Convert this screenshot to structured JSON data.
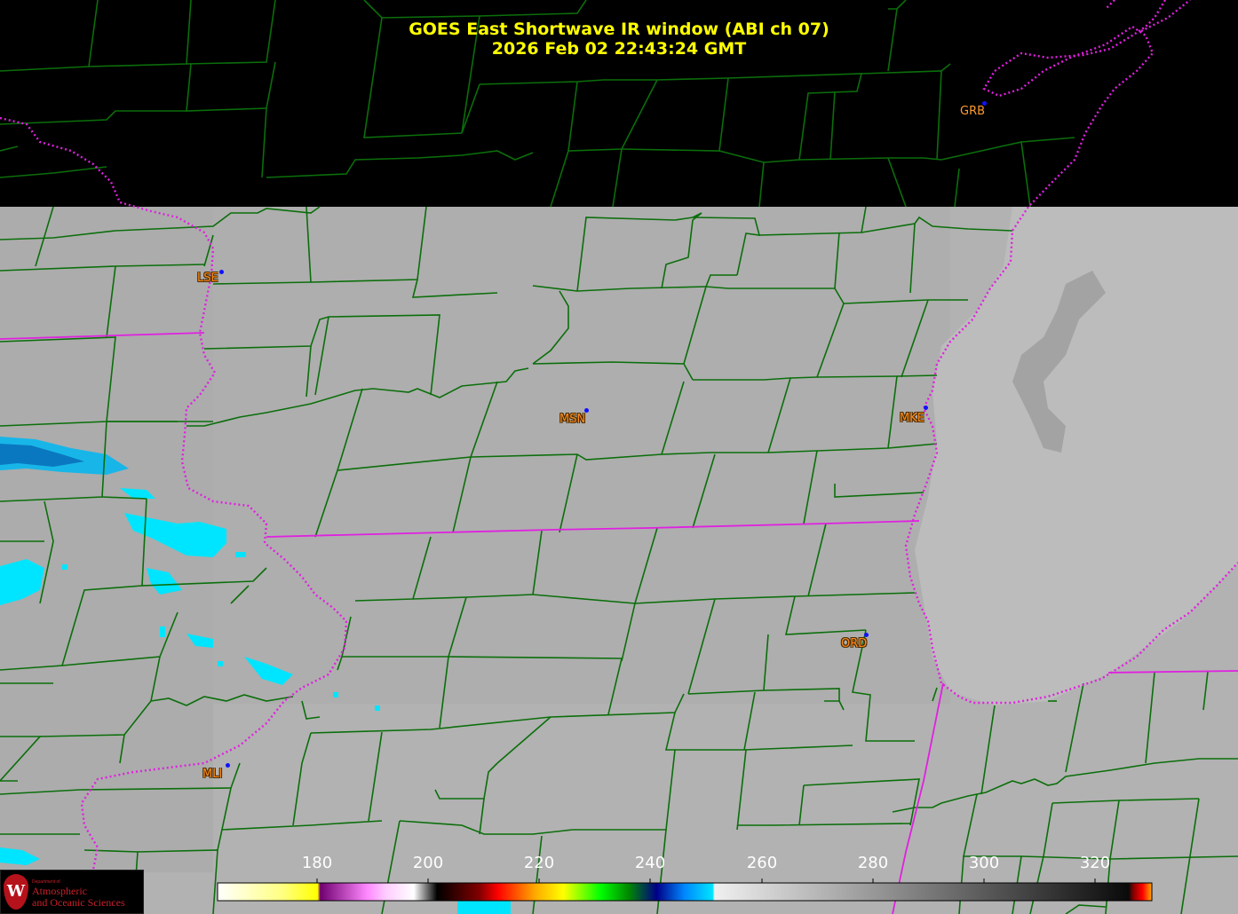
{
  "title": {
    "line1": "GOES East Shortwave IR window (ABI ch 07)",
    "line2": "2026 Feb 02  22:43:24 GMT"
  },
  "stations": [
    {
      "code": "GRB",
      "style": "plain"
    },
    {
      "code": "LSE",
      "style": "outlined"
    },
    {
      "code": "MSN",
      "style": "outlined"
    },
    {
      "code": "MKE",
      "style": "outlined"
    },
    {
      "code": "ORD",
      "style": "outlined"
    },
    {
      "code": "MLI",
      "style": "outlined"
    }
  ],
  "colorbar": {
    "ticks": [
      "180",
      "200",
      "220",
      "240",
      "260",
      "280",
      "300",
      "320"
    ],
    "units": ""
  },
  "logo": {
    "dept": "Department of",
    "line1": "Atmospheric",
    "line2": "and Oceanic Sciences",
    "shield": "W"
  },
  "colors": {
    "title": "#ffff00",
    "county_lines": "#0b6e0b",
    "state_lines": "#e020e0",
    "station_label": "#ff8c1a",
    "station_dot": "#1010ff",
    "cold_cloud": "#00e5ff"
  }
}
